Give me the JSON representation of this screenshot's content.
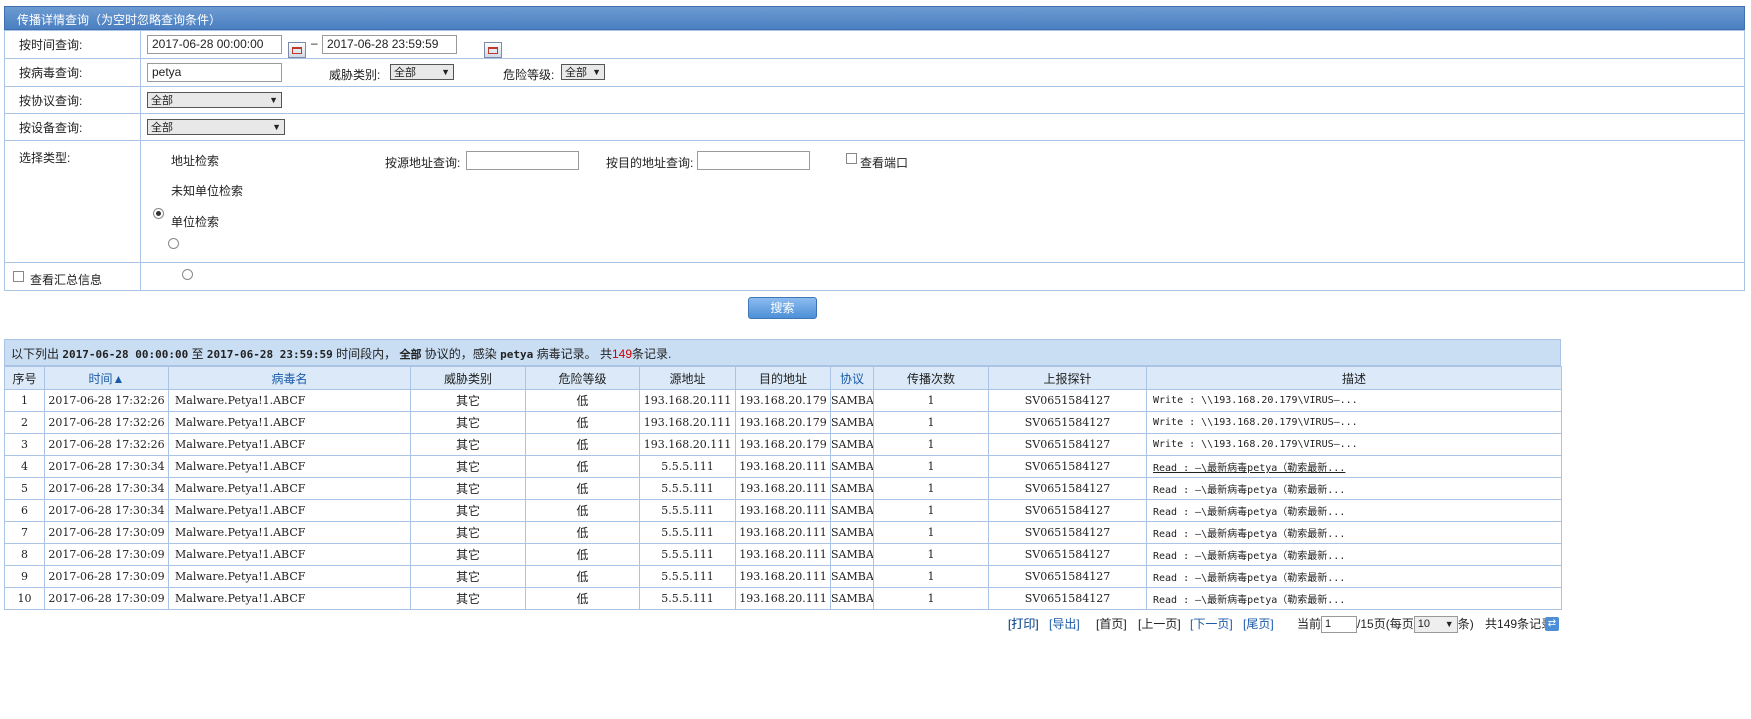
{
  "title": "传播详情查询（为空时忽略查询条件）",
  "query": {
    "time_label": "按时间查询:",
    "time_start": "2017-06-28 00:00:00",
    "time_sep": "–",
    "time_end": "2017-06-28 23:59:59",
    "virus_label": "按病毒查询:",
    "virus_value": "petya",
    "threat_label": "威胁类别:",
    "threat_value": "全部",
    "risk_label": "危险等级:",
    "risk_value": "全部",
    "protocol_label": "按协议查询:",
    "protocol_value": "全部",
    "device_label": "按设备查询:",
    "device_value": "全部",
    "type_label": "选择类型:",
    "radio_address": "地址检索",
    "radio_unknown": "未知单位检索",
    "radio_unit": "单位检索",
    "src_label": "按源地址查询:",
    "dst_label": "按目的地址查询:",
    "port_label": "查看端口",
    "summary_label": "查看汇总信息"
  },
  "search_button": "搜索",
  "result": {
    "p1": "以下列出",
    "start": "2017-06-28 00:00:00",
    "p2": "至",
    "end": "2017-06-28 23:59:59",
    "p3": "时间段内，",
    "proto": "全部",
    "p4": "协议的，感染",
    "virus": "petya",
    "p5": "病毒记录。 共",
    "count": "149",
    "p6": "条记录."
  },
  "columns": [
    "序号",
    "时间▲",
    "病毒名",
    "威胁类别",
    "危险等级",
    "源地址",
    "目的地址",
    "协议",
    "传播次数",
    "上报探针",
    "描述"
  ],
  "rows": [
    [
      "1",
      "2017-06-28 17:32:26",
      "Malware.Petya!1.ABCF",
      "其它",
      "低",
      "193.168.20.111",
      "193.168.20.179",
      "SAMBA",
      "1",
      "SV0651584127",
      "Write : \\\\193.168.20.179\\VIRUS—..."
    ],
    [
      "2",
      "2017-06-28 17:32:26",
      "Malware.Petya!1.ABCF",
      "其它",
      "低",
      "193.168.20.111",
      "193.168.20.179",
      "SAMBA",
      "1",
      "SV0651584127",
      "Write : \\\\193.168.20.179\\VIRUS—..."
    ],
    [
      "3",
      "2017-06-28 17:32:26",
      "Malware.Petya!1.ABCF",
      "其它",
      "低",
      "193.168.20.111",
      "193.168.20.179",
      "SAMBA",
      "1",
      "SV0651584127",
      "Write : \\\\193.168.20.179\\VIRUS—..."
    ],
    [
      "4",
      "2017-06-28 17:30:34",
      "Malware.Petya!1.ABCF",
      "其它",
      "低",
      "5.5.5.111",
      "193.168.20.111",
      "SAMBA",
      "1",
      "SV0651584127",
      "Read : —\\最新病毒petya（勒索最新..."
    ],
    [
      "5",
      "2017-06-28 17:30:34",
      "Malware.Petya!1.ABCF",
      "其它",
      "低",
      "5.5.5.111",
      "193.168.20.111",
      "SAMBA",
      "1",
      "SV0651584127",
      "Read : —\\最新病毒petya（勒索最新..."
    ],
    [
      "6",
      "2017-06-28 17:30:34",
      "Malware.Petya!1.ABCF",
      "其它",
      "低",
      "5.5.5.111",
      "193.168.20.111",
      "SAMBA",
      "1",
      "SV0651584127",
      "Read : —\\最新病毒petya（勒索最新..."
    ],
    [
      "7",
      "2017-06-28 17:30:09",
      "Malware.Petya!1.ABCF",
      "其它",
      "低",
      "5.5.5.111",
      "193.168.20.111",
      "SAMBA",
      "1",
      "SV0651584127",
      "Read : —\\最新病毒petya（勒索最新..."
    ],
    [
      "8",
      "2017-06-28 17:30:09",
      "Malware.Petya!1.ABCF",
      "其它",
      "低",
      "5.5.5.111",
      "193.168.20.111",
      "SAMBA",
      "1",
      "SV0651584127",
      "Read : —\\最新病毒petya（勒索最新..."
    ],
    [
      "9",
      "2017-06-28 17:30:09",
      "Malware.Petya!1.ABCF",
      "其它",
      "低",
      "5.5.5.111",
      "193.168.20.111",
      "SAMBA",
      "1",
      "SV0651584127",
      "Read : —\\最新病毒petya（勒索最新..."
    ],
    [
      "10",
      "2017-06-28 17:30:09",
      "Malware.Petya!1.ABCF",
      "其它",
      "低",
      "5.5.5.111",
      "193.168.20.111",
      "SAMBA",
      "1",
      "SV0651584127",
      "Read : —\\最新病毒petya（勒索最新..."
    ]
  ],
  "pager": {
    "print": "[打印]",
    "export": "[导出]",
    "first": "[首页]",
    "prev": "[上一页]",
    "next": "[下一页]",
    "last": "[尾页]",
    "current_label": "当前",
    "current_page": "1",
    "total_pages": "/15页(每页",
    "per_page": "10",
    "per_page_suffix": "条)",
    "total_records": "共149条记录"
  }
}
